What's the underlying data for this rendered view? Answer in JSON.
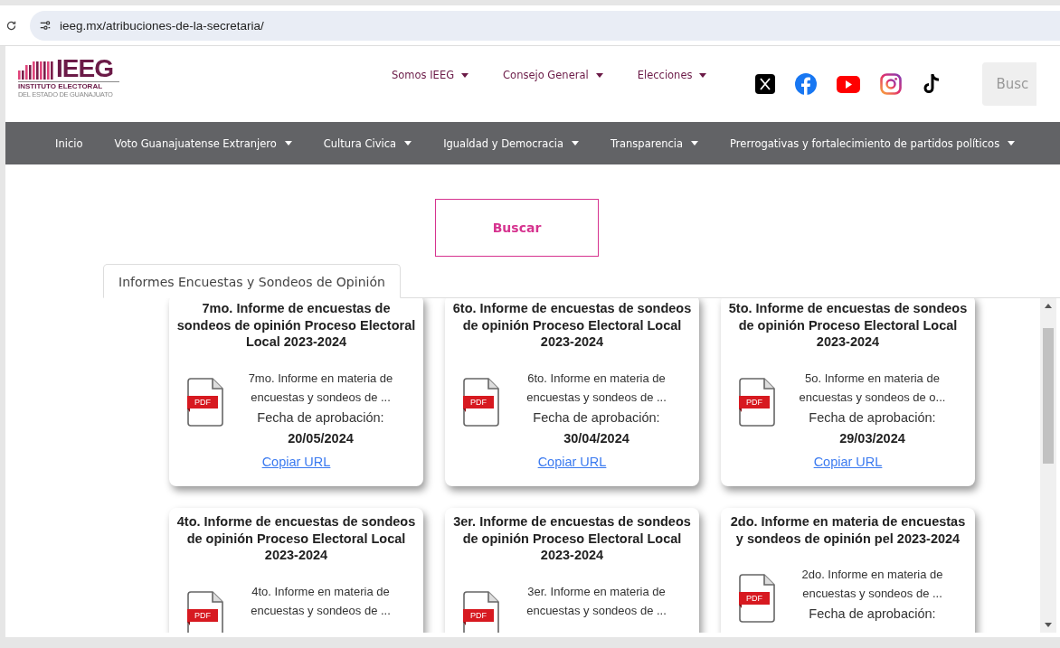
{
  "browser": {
    "url": "ieeg.mx/atribuciones-de-la-secretaria/"
  },
  "logo": {
    "name": "IEEG",
    "line_1": "INSTITUTO ELECTORAL",
    "line_2": "DEL ESTADO DE GUANAJUATO"
  },
  "top_menu": [
    {
      "label": "Somos IEEG"
    },
    {
      "label": "Consejo General"
    },
    {
      "label": "Elecciones"
    }
  ],
  "search": {
    "placeholder": "Busc"
  },
  "nav": [
    {
      "label": "Inicio",
      "dropdown": false
    },
    {
      "label": "Voto Guanajuatense Extranjero",
      "dropdown": true
    },
    {
      "label": "Cultura Civica",
      "dropdown": true
    },
    {
      "label": "Igualdad y Democracia",
      "dropdown": true
    },
    {
      "label": "Transparencia",
      "dropdown": true
    },
    {
      "label": "Prerrogativas y fortalecimiento de partidos políticos",
      "dropdown": true
    }
  ],
  "search_button": "Buscar",
  "tabs": [
    {
      "label": "Informes Encuestas y Sondeos de Opinión",
      "selected": true
    }
  ],
  "cards": [
    {
      "title": "7mo. Informe de encuestas de sondeos de opinión Proceso Electoral Local 2023-2024",
      "file_type": "PDF",
      "description": [
        "7mo. Informe en materia de",
        "encuestas y sondeos de ..."
      ],
      "date_label": "Fecha de aprobación:",
      "date": "20/05/2024",
      "link": "Copiar URL"
    },
    {
      "title": "6to. Informe de encuestas de sondeos de opinión Proceso Electoral Local 2023-2024",
      "file_type": "PDF",
      "description": [
        "6to. Informe en materia de",
        "encuestas y sondeos de ..."
      ],
      "date_label": "Fecha de aprobación:",
      "date": "30/04/2024",
      "link": "Copiar URL"
    },
    {
      "title": "5to. Informe de encuestas de sondeos de opinión Proceso Electoral Local 2023-2024",
      "file_type": "PDF",
      "description": [
        "5o. Informe en materia de",
        "encuestas y sondeos de o..."
      ],
      "date_label": "Fecha de aprobación:",
      "date": "29/03/2024",
      "link": "Copiar URL"
    },
    {
      "title": "4to. Informe de encuestas de sondeos de opinión Proceso Electoral Local 2023-2024",
      "file_type": "PDF",
      "description": [
        "4to. Informe en materia de",
        "encuestas y sondeos de ..."
      ]
    },
    {
      "title": "3er. Informe de encuestas de sondeos de opinión Proceso Electoral Local 2023-2024",
      "file_type": "PDF",
      "description": [
        "3er. Informe en materia de",
        "encuestas y sondeos de ..."
      ]
    },
    {
      "title": "2do. Informe en materia de encuestas y sondeos de opinión pel 2023-2024",
      "file_type": "PDF",
      "description": [
        "2do. Informe en materia de",
        "encuestas y sondeos de ..."
      ],
      "date_label": "Fecha de aprobación:"
    }
  ]
}
